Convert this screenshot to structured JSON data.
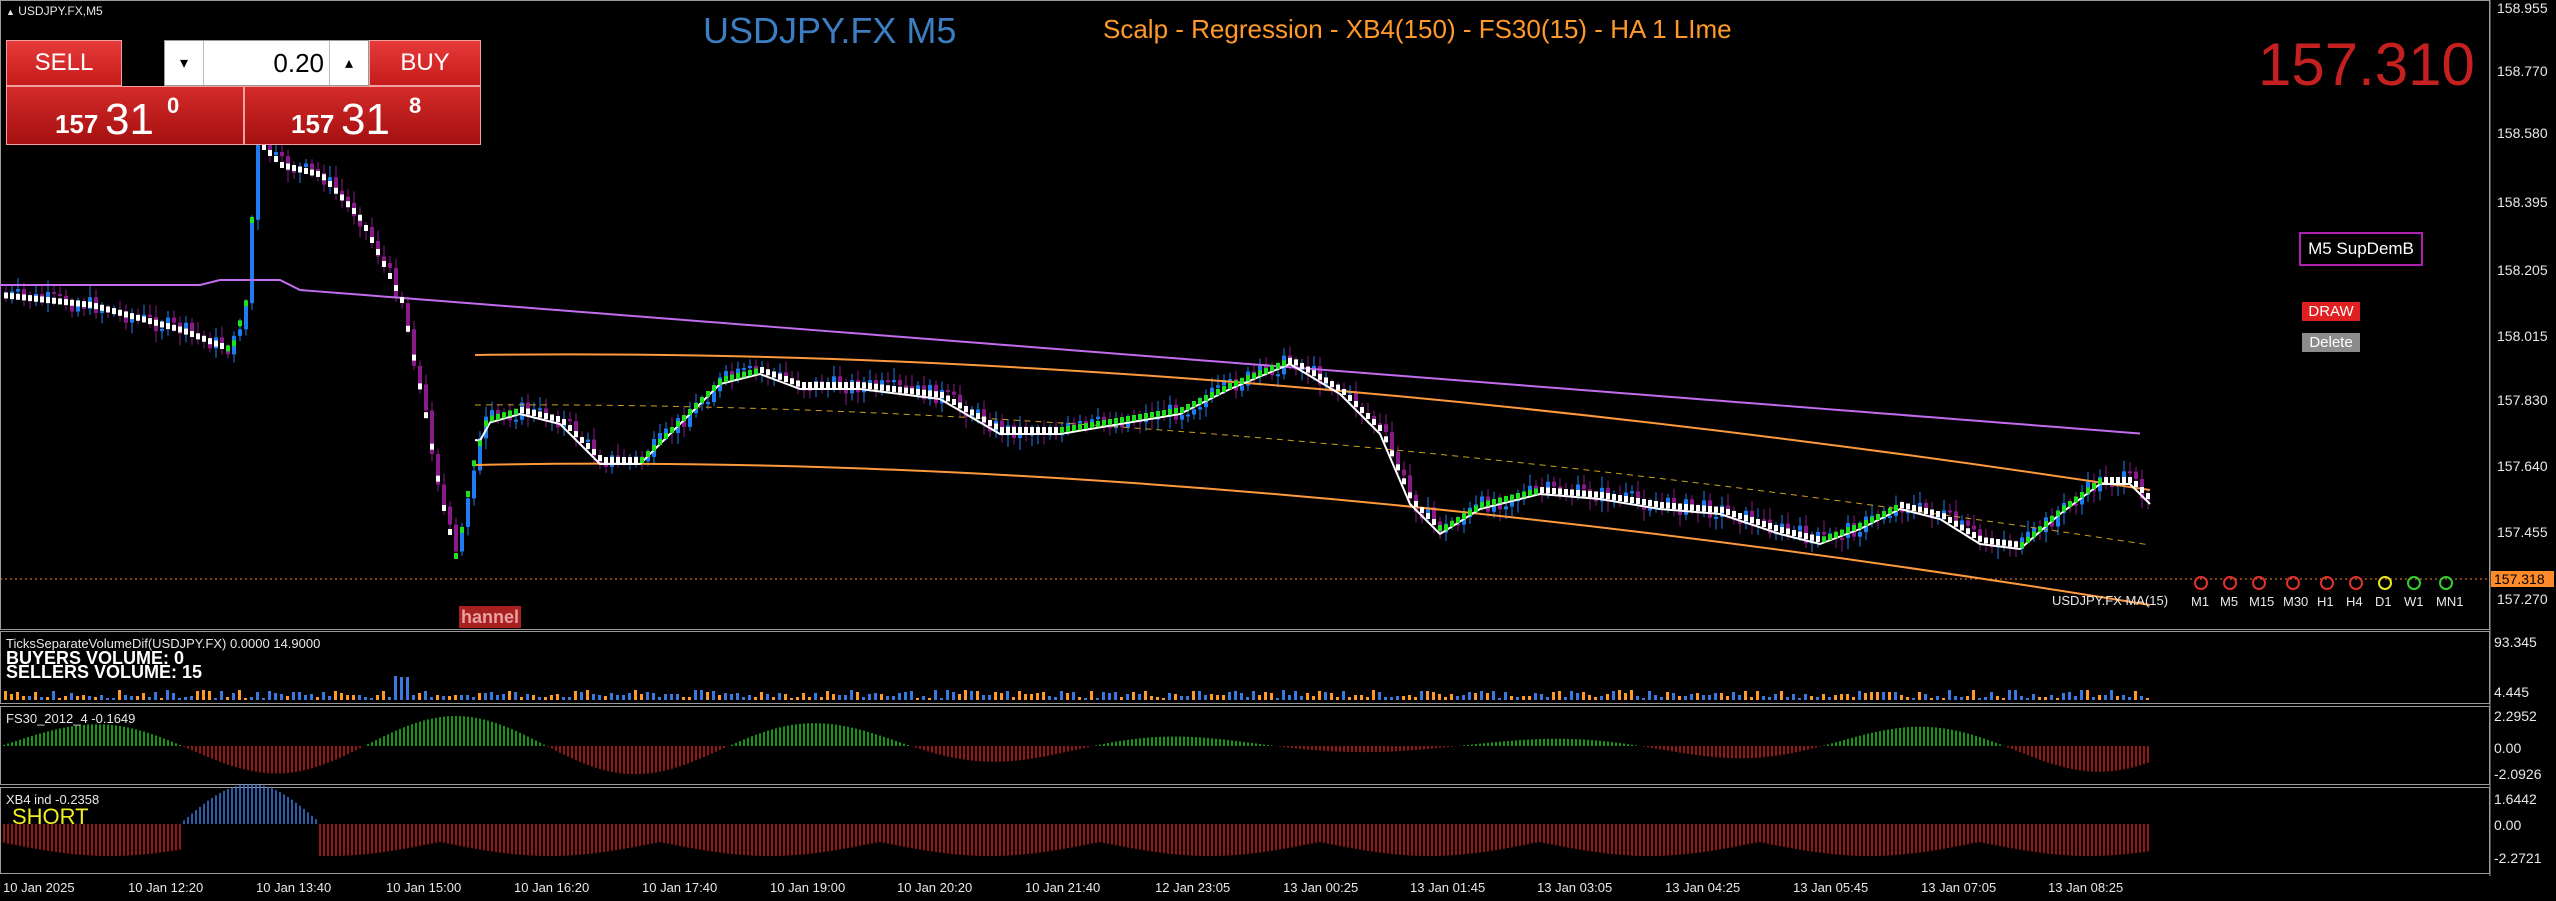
{
  "window": {
    "title": "USDJPY.FX,M5"
  },
  "header": {
    "symbol_title": "USDJPY.FX M5",
    "indicator_title": "Scalp - Regression - XB4(150) - FS30(15) - HA  1 LIme",
    "big_price": "157.310"
  },
  "trade_panel": {
    "sell_label": "SELL",
    "buy_label": "BUY",
    "lot_value": "0.20",
    "down_arrow": "▾",
    "up_arrow": "▴",
    "sell_price_big": "157",
    "sell_price_mid": "31",
    "sell_price_sup": "0",
    "buy_price_big": "157",
    "buy_price_mid": "31",
    "buy_price_sup": "8"
  },
  "side_buttons": {
    "supdem_label": "M5 SupDemB",
    "draw_label": "DRAW",
    "delete_label": "Delete"
  },
  "price_axis": {
    "labels": [
      "158.955",
      "158.770",
      "158.580",
      "158.395",
      "158.205",
      "158.015",
      "157.830",
      "157.640",
      "157.455",
      "157.270"
    ],
    "current_price_tag": "157.318"
  },
  "time_axis": {
    "labels": [
      "10 Jan 2025",
      "10 Jan 12:20",
      "10 Jan 13:40",
      "10 Jan 15:00",
      "10 Jan 16:20",
      "10 Jan 17:40",
      "10 Jan 19:00",
      "10 Jan 20:20",
      "10 Jan 21:40",
      "12 Jan 23:05",
      "13 Jan 00:25",
      "13 Jan 01:45",
      "13 Jan 03:05",
      "13 Jan 04:25",
      "13 Jan 05:45",
      "13 Jan 07:05",
      "13 Jan 08:25"
    ]
  },
  "timeframes": [
    "M1",
    "M5",
    "M15",
    "M30",
    "H1",
    "H4",
    "D1",
    "W1",
    "MN1"
  ],
  "timeframe_colors": [
    "#e03030",
    "#e03030",
    "#e03030",
    "#e03030",
    "#e03030",
    "#e03030",
    "#e8e820",
    "#30d030",
    "#30d030"
  ],
  "chart_labels": {
    "ma_label": "USDJPY.FX MA(15)",
    "channel_label": "hannel"
  },
  "volume_panel": {
    "title": "TicksSeparateVolumeDif(USDJPY.FX) 0.0000 14.9000",
    "buyers": "BUYERS VOLUME: 0",
    "sellers": "SELLERS VOLUME: 15",
    "scale_top": "93.345",
    "scale_bottom": "4.445"
  },
  "fs30_panel": {
    "title": "FS30_2012_4 -0.1649",
    "scale": [
      "2.2952",
      "0.00",
      "-2.0926"
    ]
  },
  "xb4_panel": {
    "title": "XB4 ind -0.2358",
    "signal": "SHORT",
    "scale": [
      "1.6442",
      "0.00",
      "-2.2721"
    ]
  },
  "colors": {
    "bull": "#1e7bf0",
    "bear": "#8a1a8a",
    "ha_up": "#1ee01e",
    "ha_down": "#ffffff",
    "channel": "#ff9a3c",
    "ma_purple": "#c26cf0",
    "regression": "#ffffff",
    "osc_green": "#1ec81e",
    "osc_red": "#c81e1e",
    "osc_blue": "#3a7ae0",
    "accent_red": "#d42a2a"
  }
}
